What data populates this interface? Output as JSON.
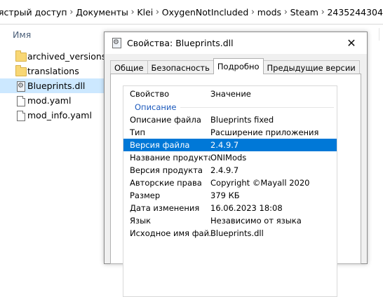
{
  "explorer": {
    "breadcrumbs": [
      "ястрый доступ",
      "Документы",
      "Klei",
      "OxygenNotIncluded",
      "mods",
      "Steam",
      "2435244304"
    ],
    "column_header": "Имя",
    "files": [
      {
        "name": "archived_versions",
        "type": "folder",
        "icon": "folder-icon"
      },
      {
        "name": "translations",
        "type": "folder",
        "icon": "folder-icon"
      },
      {
        "name": "Blueprints.dll",
        "type": "dll",
        "icon": "dll-file-icon",
        "selected": true
      },
      {
        "name": "mod.yaml",
        "type": "file",
        "icon": "file-icon"
      },
      {
        "name": "mod_info.yaml",
        "type": "file",
        "icon": "file-icon"
      }
    ]
  },
  "dialog": {
    "title": "Свойства: Blueprints.dll",
    "close_glyph": "✕",
    "tabs": [
      {
        "label": "Общие",
        "active": false
      },
      {
        "label": "Безопасность",
        "active": false
      },
      {
        "label": "Подробно",
        "active": true
      },
      {
        "label": "Предыдущие версии",
        "active": false
      }
    ],
    "details": {
      "header_property": "Свойство",
      "header_value": "Значение",
      "group": "Описание",
      "rows": [
        {
          "name": "Описание файла",
          "value": "Blueprints fixed",
          "selected": false
        },
        {
          "name": "Тип",
          "value": "Расширение приложения",
          "selected": false
        },
        {
          "name": "Версия файла",
          "value": "2.4.9.7",
          "selected": true
        },
        {
          "name": "Название продукта",
          "value": "ONIMods",
          "selected": false
        },
        {
          "name": "Версия продукта",
          "value": "2.4.9.7",
          "selected": false
        },
        {
          "name": "Авторские права",
          "value": "Copyright ©Mayall 2020",
          "selected": false
        },
        {
          "name": "Размер",
          "value": "379 КБ",
          "selected": false
        },
        {
          "name": "Дата изменения",
          "value": "16.06.2023 18:08",
          "selected": false
        },
        {
          "name": "Язык",
          "value": "Независимо от языка",
          "selected": false
        },
        {
          "name": "Исходное имя файла",
          "value": "Blueprints.dll",
          "selected": false
        }
      ]
    }
  },
  "colors": {
    "selection_blue": "#0078d7",
    "explorer_selection": "#cce8ff",
    "group_label": "#1e5bbd"
  }
}
